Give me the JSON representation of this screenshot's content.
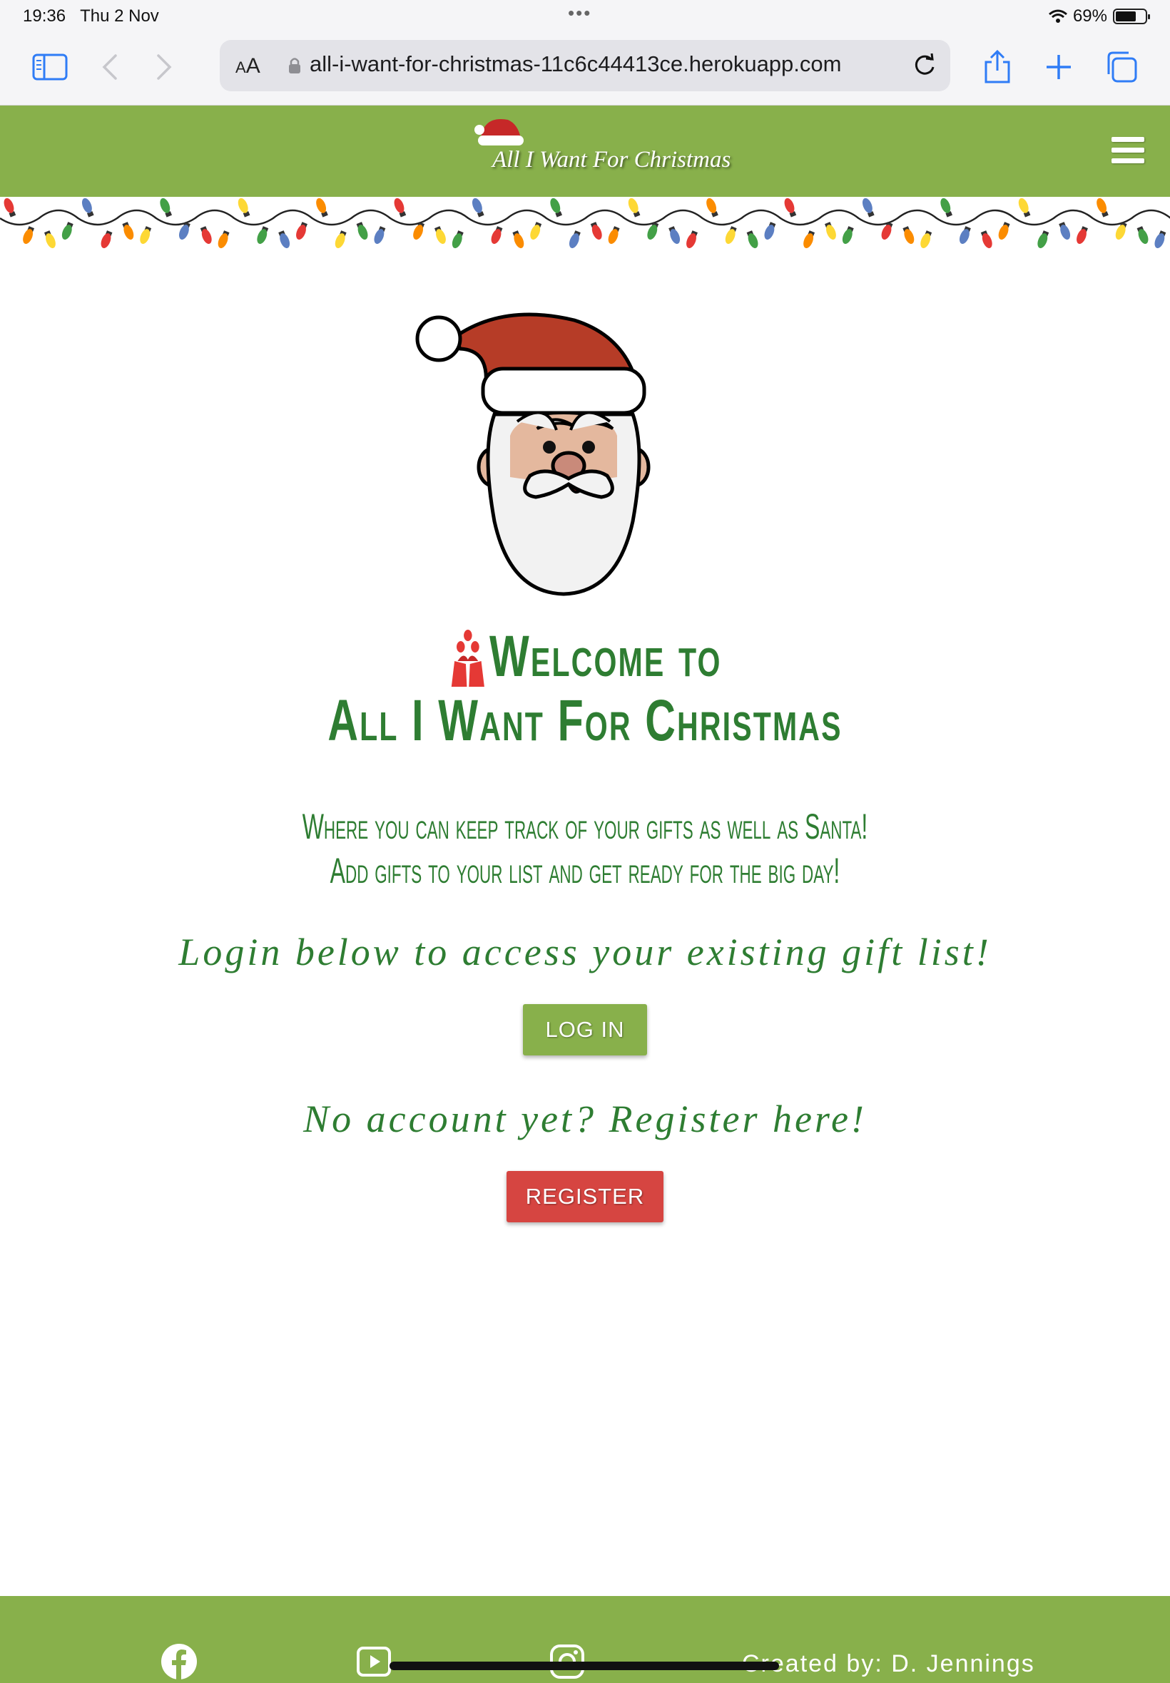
{
  "status_bar": {
    "time": "19:36",
    "date": "Thu 2 Nov",
    "battery": "69%",
    "battery_level": 0.69
  },
  "browser": {
    "text_size_label": "AA",
    "url": "all-i-want-for-christmas-11c6c44413ce.herokuapp.com",
    "icons": [
      "sidebar-icon",
      "back-icon",
      "forward-icon",
      "lock-icon",
      "reload-icon",
      "share-icon",
      "new-tab-icon",
      "tabs-icon"
    ]
  },
  "header": {
    "brand": "All I Want For Christmas",
    "menu_icon": "hamburger-icon",
    "accent_color": "#88b04b"
  },
  "welcome": {
    "line1": "Welcome to",
    "line2": "All I Want For Christmas"
  },
  "subtitle": {
    "line1": "Where you can keep track of your gifts as well as Santa!",
    "line2": "Add gifts to your list and get ready for the big day!"
  },
  "login": {
    "prompt": "Login below to access your existing gift list!",
    "button": "LOG IN",
    "color": "#88b04b"
  },
  "register": {
    "prompt": "No account yet? Register here!",
    "button": "REGISTER",
    "color": "#d64541"
  },
  "footer": {
    "social_icons": [
      "facebook-icon",
      "youtube-icon",
      "instagram-icon"
    ],
    "credit": "Created by: D. Jennings"
  },
  "text_color": "#2e7d32"
}
